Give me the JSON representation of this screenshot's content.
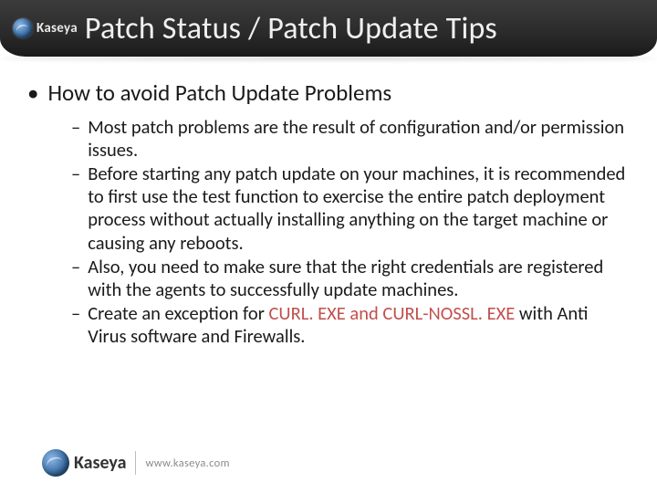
{
  "brand": "Kaseya",
  "title": "Patch Status / Patch Update Tips",
  "main_bullet": "How to avoid Patch Update Problems",
  "sub_bullets": [
    {
      "text": "Most patch problems are the result of configuration and/or permission issues."
    },
    {
      "text": "Before starting any patch update on your machines, it is recommended to first use the test function to exercise the entire patch deployment process without actually installing anything on the target machine or causing any reboots."
    },
    {
      "text": "Also, you need to make sure that the right credentials are registered with the agents to successfully update machines."
    },
    {
      "prefix": "Create an exception for ",
      "highlight": "CURL. EXE and CURL-NOSSL. EXE",
      "suffix": " with Anti Virus software and Firewalls."
    }
  ],
  "footer_url": "www.kaseya.com"
}
